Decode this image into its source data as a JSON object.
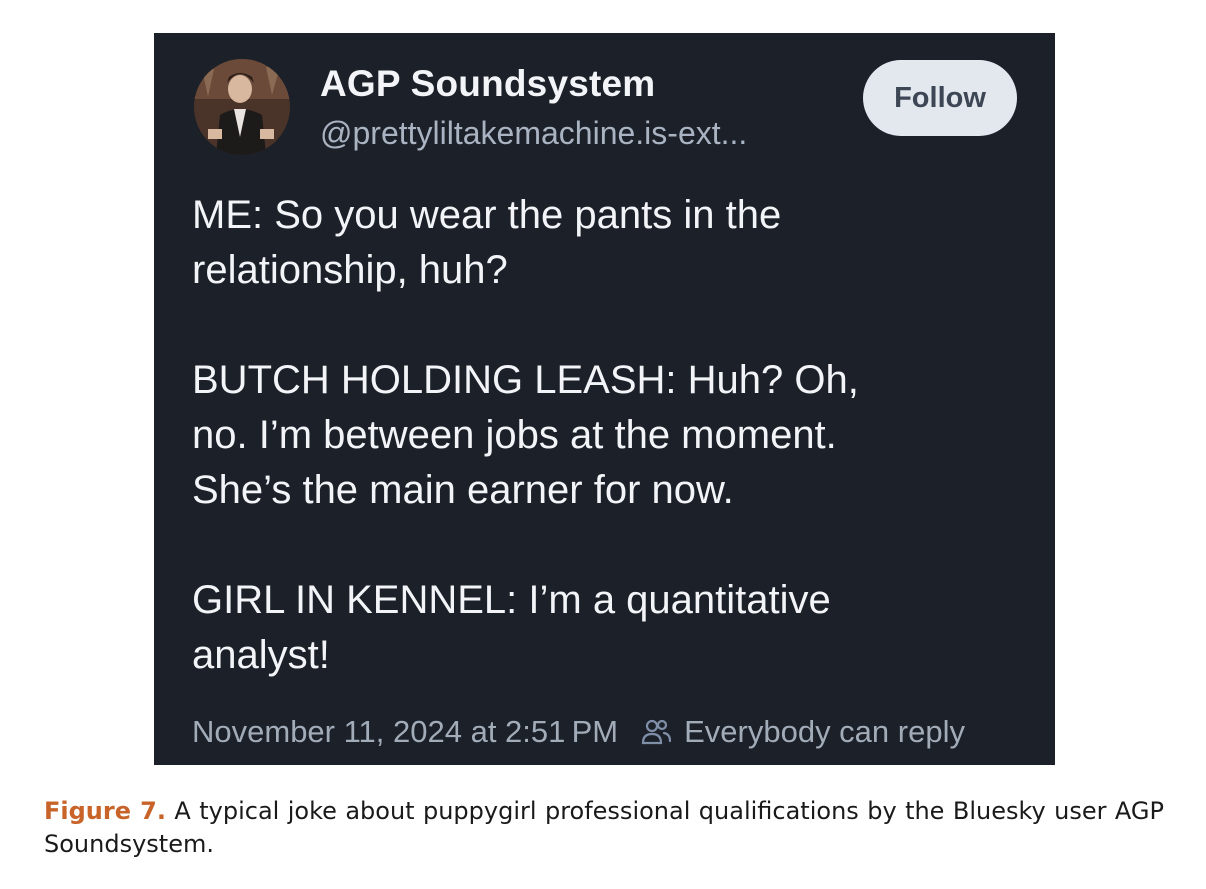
{
  "post": {
    "display_name": "AGP Soundsystem",
    "handle": "@prettyliltakemachine.is-ext...",
    "follow_label": "Follow",
    "paragraphs": [
      "ME: So you wear the pants in the\nrelationship, huh?",
      "BUTCH HOLDING LEASH: Huh? Oh,\nno. I’m between jobs at the moment.\nShe’s the main earner for now.",
      "GIRL IN KENNEL: I’m a quantitative\nanalyst!"
    ],
    "timestamp": "November 11, 2024 at 2:51 PM",
    "reply_setting": "Everybody can reply",
    "reply_icon": "people-icon",
    "colors": {
      "card_background": "#1b2029",
      "follow_button": "#e3e8ee",
      "muted_text": "#a2acb9"
    }
  },
  "caption": {
    "label": "Figure 7.",
    "text": "A typical joke about puppygirl professional qualifications by the Bluesky user AGP Soundsystem.",
    "label_color": "#c8642a"
  }
}
